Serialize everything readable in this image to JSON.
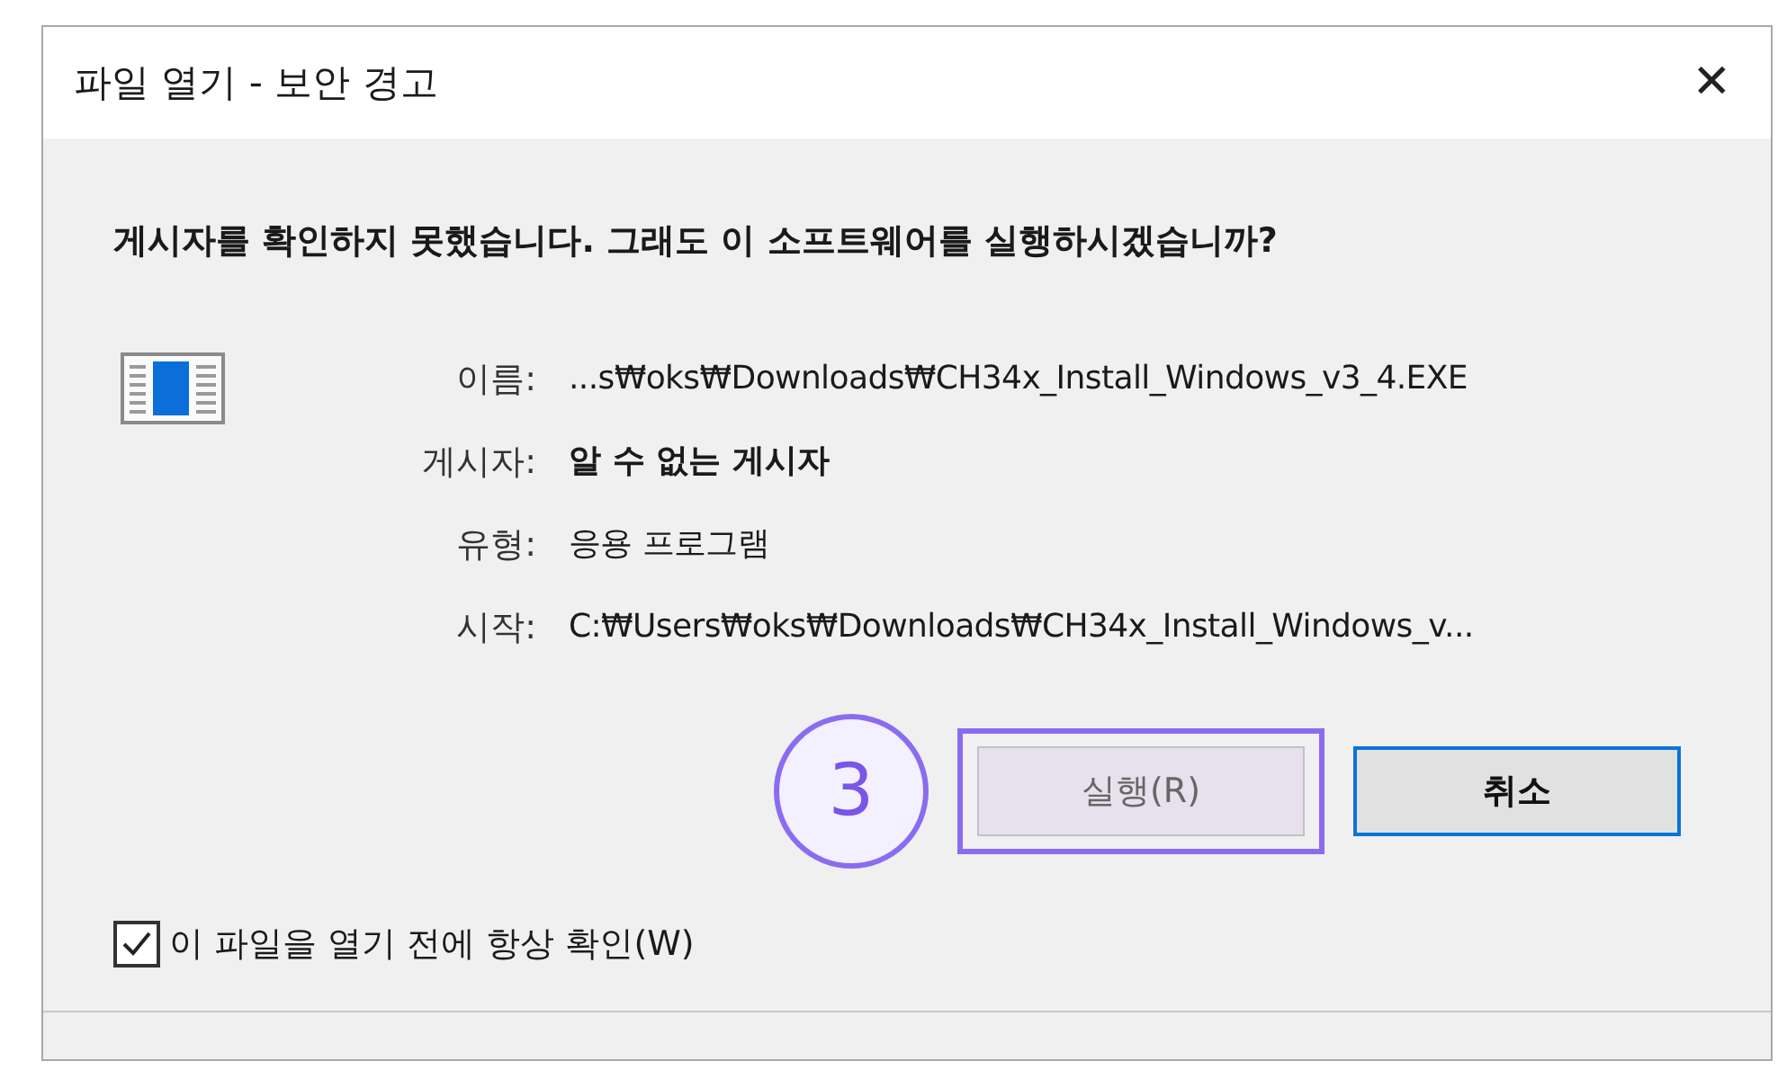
{
  "window": {
    "title": "파일 열기 - 보안 경고",
    "close": "✕"
  },
  "question": "게시자를 확인하지 못했습니다. 그래도 이 소프트웨어를 실행하시겠습니까?",
  "details": [
    {
      "label": "이름:",
      "value": "...s₩oks₩Downloads₩CH34x_Install_Windows_v3_4.EXE",
      "bold": false
    },
    {
      "label": "게시자:",
      "value": "알 수 없는 게시자",
      "bold": true
    },
    {
      "label": "유형:",
      "value": "응용 프로그램",
      "bold": false
    },
    {
      "label": "시작:",
      "value": "C:₩Users₩oks₩Downloads₩CH34x_Install_Windows_v...",
      "bold": false
    }
  ],
  "step_marker": "3",
  "buttons": [
    {
      "label": "실행(R)",
      "highlighted": true,
      "default": false
    },
    {
      "label": "취소",
      "highlighted": false,
      "default": true
    }
  ],
  "checkbox": {
    "label": "이 파일을 열기 전에 항상 확인(W)",
    "checked": true
  }
}
